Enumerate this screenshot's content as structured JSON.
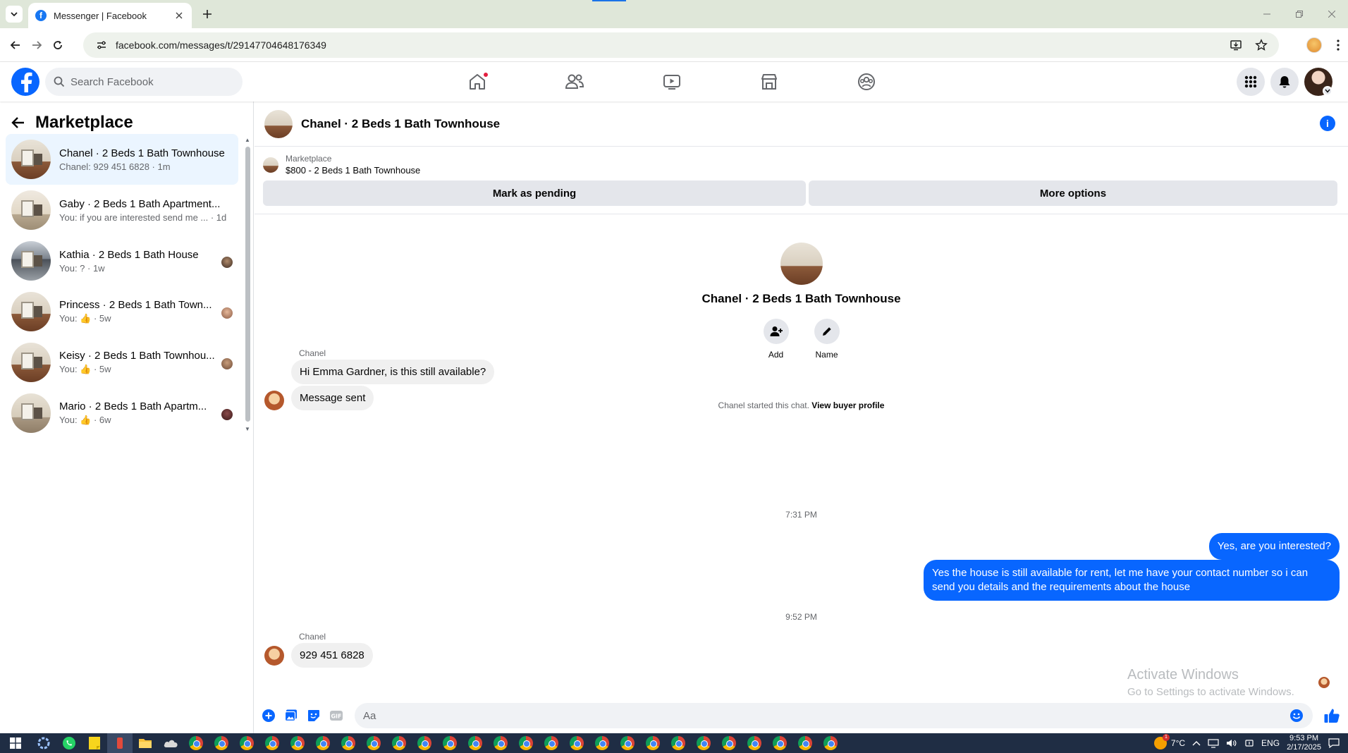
{
  "browser": {
    "tab_title": "Messenger | Facebook",
    "url": "facebook.com/messages/t/29147704648176349"
  },
  "header": {
    "search_placeholder": "Search Facebook",
    "nav": [
      "home-icon",
      "friends-icon",
      "video-icon",
      "marketplace-icon",
      "groups-icon"
    ]
  },
  "sidebar": {
    "title": "Marketplace",
    "conversations": [
      {
        "name": "Chanel · 2 Beds 1 Bath Townhouse",
        "sub": "Chanel: 929 451 6828 · 1m",
        "active": true
      },
      {
        "name": "Gaby · 2 Beds 1 Bath Apartment...",
        "sub": "You: if you are interested send me ... · 1d"
      },
      {
        "name": "Kathia · 2 Beds 1 Bath House",
        "sub": "You: ? · 1w"
      },
      {
        "name": "Princess · 2 Beds 1 Bath Town...",
        "sub": "You: 👍 · 5w"
      },
      {
        "name": "Keisy · 2 Beds 1 Bath Townhou...",
        "sub": "You: 👍 · 5w"
      },
      {
        "name": "Mario · 2 Beds 1 Bath Apartm...",
        "sub": "You: 👍 · 6w"
      }
    ]
  },
  "chat": {
    "title": "Chanel · 2 Beds 1 Bath Townhouse",
    "listing_label": "Marketplace",
    "listing_price": "$800 - 2 Beds 1 Bath Townhouse",
    "mark_pending": "Mark as pending",
    "more_options": "More options",
    "intro_name": "Chanel · 2 Beds 1 Bath Townhouse",
    "add_label": "Add",
    "name_label": "Name",
    "system_text": "Chanel started this chat.",
    "buyer_profile_link": "View buyer profile",
    "sender": "Chanel",
    "msg1": "Hi Emma Gardner, is this still available?",
    "msg2": "Message sent",
    "time1": "7:31 PM",
    "out1": "Yes, are you interested?",
    "out2": "Yes the house is still available for rent, let me have your contact number  so i can send you details and the requirements about the house",
    "time2": "9:52 PM",
    "msg3": "929 451 6828",
    "composer_placeholder": "Aa"
  },
  "watermark": {
    "line1": "Activate Windows",
    "line2": "Go to Settings to activate Windows."
  },
  "taskbar": {
    "temperature": "7°C",
    "language": "ENG",
    "time": "9:53 PM",
    "date": "2/17/2025"
  },
  "colors": {
    "fb_blue": "#0866ff",
    "bubble_in": "#f0f0f0",
    "active_row": "#ebf5ff"
  }
}
